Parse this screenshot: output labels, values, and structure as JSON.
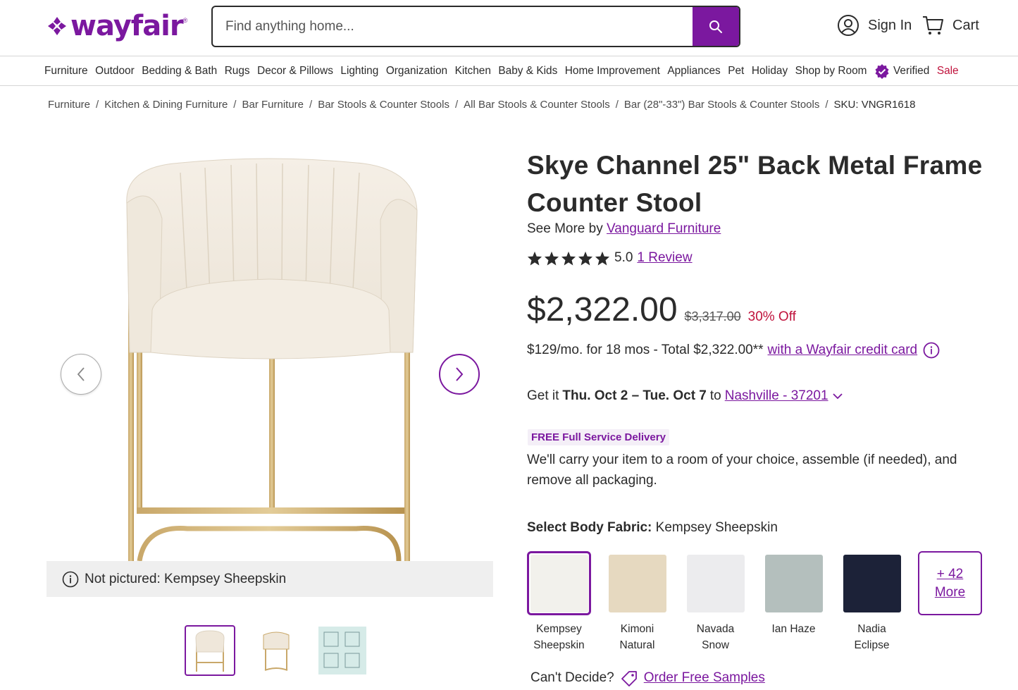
{
  "header": {
    "logo_text": "wayfair",
    "search_placeholder": "Find anything home...",
    "sign_in_label": "Sign In",
    "cart_label": "Cart"
  },
  "nav": {
    "items": [
      "Furniture",
      "Outdoor",
      "Bedding & Bath",
      "Rugs",
      "Decor & Pillows",
      "Lighting",
      "Organization",
      "Kitchen",
      "Baby & Kids",
      "Home Improvement",
      "Appliances",
      "Pet",
      "Holiday",
      "Shop by Room"
    ],
    "verified_label": "Verified",
    "sale_label": "Sale"
  },
  "breadcrumb": {
    "items": [
      "Furniture",
      "Kitchen & Dining Furniture",
      "Bar Furniture",
      "Bar Stools & Counter Stools",
      "All Bar Stools & Counter Stools",
      "Bar (28\"-33\") Bar Stools & Counter Stools"
    ],
    "separator": "/",
    "sku": "SKU: VNGR1618"
  },
  "gallery": {
    "not_pictured": "Not pictured: Kempsey Sheepskin",
    "thumbnail_count": 3
  },
  "product": {
    "title": "Skye Channel 25\" Back Metal Frame Counter Stool",
    "see_more_prefix": "See More by",
    "brand": "Vanguard Furniture",
    "rating_value": "5.0",
    "rating_stars": 5,
    "review_link": "1 Review",
    "price": "$2,322.00",
    "old_price": "$3,317.00",
    "discount": "30% Off",
    "financing_text": "$129/mo. for 18 mos - Total $2,322.00**",
    "financing_link": "with a Wayfair credit card",
    "delivery_prefix": "Get it",
    "delivery_dates": "Thu. Oct 2 – Tue. Oct 7",
    "delivery_to": "to",
    "delivery_location": "Nashville - 37201",
    "free_delivery_badge": "FREE Full Service Delivery",
    "service_text": "We'll carry your item to a room of your choice, assemble (if needed), and remove all packaging.",
    "fabric_label": "Select Body Fabric:",
    "fabric_selected": "Kempsey Sheepskin",
    "swatches": [
      {
        "line1": "Kempsey",
        "line2": "Sheepskin",
        "color": "#f2f1ec"
      },
      {
        "line1": "Kimoni",
        "line2": "Natural",
        "color": "#e6d9c0"
      },
      {
        "line1": "Navada",
        "line2": "Snow",
        "color": "#ececee"
      },
      {
        "line1": "Ian Haze",
        "line2": "",
        "color": "#b4bfbd"
      },
      {
        "line1": "Nadia",
        "line2": "Eclipse",
        "color": "#1c2238"
      }
    ],
    "more_line1": "+ 42",
    "more_line2": "More",
    "cant_decide": "Can't Decide?",
    "order_samples": "Order Free Samples"
  },
  "colors": {
    "brand_purple": "#7b189f",
    "sale_red": "#c0123c"
  }
}
